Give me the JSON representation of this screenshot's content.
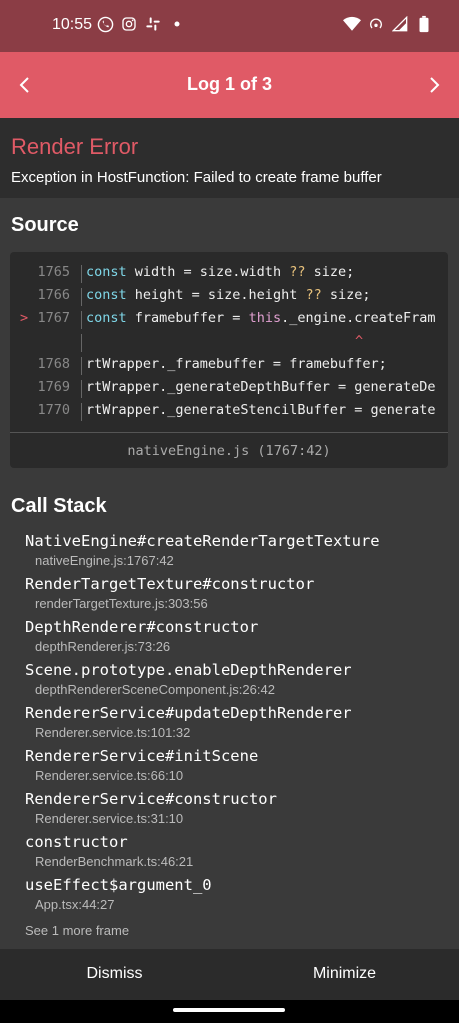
{
  "status_bar": {
    "time": "10:55"
  },
  "header": {
    "title": "Log 1 of 3"
  },
  "error": {
    "title": "Render Error",
    "message": "Exception in HostFunction: Failed to create frame buffer"
  },
  "source": {
    "heading": "Source",
    "lines": [
      {
        "num": "1765",
        "segments": [
          [
            "const",
            "kw"
          ],
          [
            " width = size.width ",
            ""
          ],
          [
            "??",
            "kwy"
          ],
          [
            " size;",
            ""
          ]
        ]
      },
      {
        "num": "1766",
        "segments": [
          [
            "const",
            "kw"
          ],
          [
            " height = size.height ",
            ""
          ],
          [
            "??",
            "kwy"
          ],
          [
            " size;",
            ""
          ]
        ]
      },
      {
        "num": "1767",
        "mark": ">",
        "segments": [
          [
            "const",
            "kw"
          ],
          [
            " framebuffer = ",
            ""
          ],
          [
            "this",
            "kwp"
          ],
          [
            "._engine.createFram",
            ""
          ]
        ]
      },
      {
        "num": "",
        "segments": []
      },
      {
        "num": "1768",
        "segments": [
          [
            "rtWrapper._framebuffer = framebuffer;",
            ""
          ]
        ]
      },
      {
        "num": "1769",
        "segments": [
          [
            "rtWrapper._generateDepthBuffer = generateDe",
            ""
          ]
        ]
      },
      {
        "num": "1770",
        "segments": [
          [
            "rtWrapper._generateStencilBuffer = generate",
            ""
          ]
        ]
      }
    ],
    "caret": "^",
    "file_ref": "nativeEngine.js (1767:42)"
  },
  "call_stack": {
    "heading": "Call Stack",
    "frames": [
      {
        "fn": "NativeEngine#createRenderTargetTexture",
        "loc": "nativeEngine.js:1767:42"
      },
      {
        "fn": "RenderTargetTexture#constructor",
        "loc": "renderTargetTexture.js:303:56"
      },
      {
        "fn": "DepthRenderer#constructor",
        "loc": "depthRenderer.js:73:26"
      },
      {
        "fn": "Scene.prototype.enableDepthRenderer",
        "loc": "depthRendererSceneComponent.js:26:42"
      },
      {
        "fn": "RendererService#updateDepthRenderer",
        "loc": "Renderer.service.ts:101:32"
      },
      {
        "fn": "RendererService#initScene",
        "loc": "Renderer.service.ts:66:10"
      },
      {
        "fn": "RendererService#constructor",
        "loc": "Renderer.service.ts:31:10"
      },
      {
        "fn": "constructor",
        "loc": "RenderBenchmark.ts:46:21"
      },
      {
        "fn": "useEffect$argument_0",
        "loc": "App.tsx:44:27"
      }
    ],
    "see_more": "See 1 more frame"
  },
  "footer": {
    "dismiss": "Dismiss",
    "minimize": "Minimize"
  },
  "colors": {
    "accent": "#e05a66",
    "status_bar": "#8b3d45",
    "background": "#3a3a3a"
  }
}
